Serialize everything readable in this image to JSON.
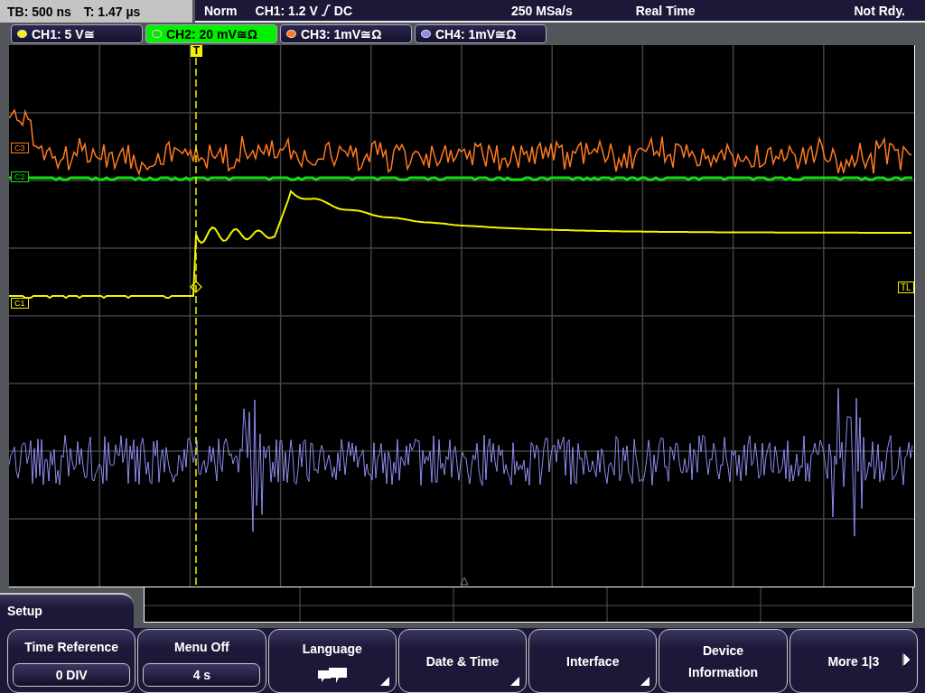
{
  "status_bar": {
    "timebase": "TB: 500 ns",
    "trigger_time": "T: 1.47 µs",
    "mode": "Norm",
    "trigger_setting": "CH1: 1.2 V",
    "trigger_coupling": "DC",
    "sample_rate": "250 MSa/s",
    "acquisition": "Real Time",
    "state": "Not Rdy."
  },
  "channels": [
    {
      "label": "CH1: 5 V≅",
      "color": "#f4f400",
      "selected": false
    },
    {
      "label": "CH2: 20 mV≅Ω",
      "color": "#10e010",
      "selected": true
    },
    {
      "label": "CH3: 1mV≅Ω",
      "color": "#ff7a20",
      "selected": false
    },
    {
      "label": "CH4: 1mV≅Ω",
      "color": "#8c8cf0",
      "selected": false
    }
  ],
  "screen": {
    "trigger_marker": "T",
    "trigger_level": "TL",
    "markers": [
      {
        "label": "C3",
        "color": "#ff7a20"
      },
      {
        "label": "C2",
        "color": "#10e010"
      },
      {
        "label": "C1",
        "color": "#f4f400"
      }
    ]
  },
  "menu": {
    "title": "Setup",
    "softkeys": [
      {
        "kind": "value",
        "label": "Time Reference",
        "value": "0 DIV"
      },
      {
        "kind": "value",
        "label": "Menu Off",
        "value": "4 s"
      },
      {
        "kind": "icon",
        "label": "Language",
        "submenu": true
      },
      {
        "kind": "plain",
        "label": "Date & Time",
        "submenu": true
      },
      {
        "kind": "plain",
        "label": "Interface",
        "submenu": true
      },
      {
        "kind": "plain",
        "label": "Device Information",
        "submenu": false
      },
      {
        "kind": "next",
        "label": "More 1|3"
      }
    ]
  }
}
